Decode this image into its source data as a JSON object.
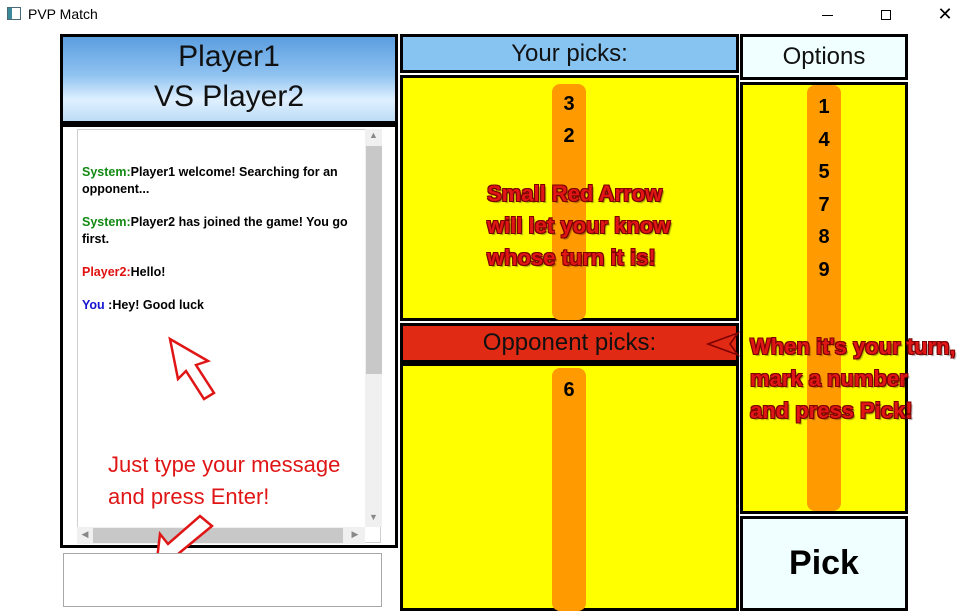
{
  "window": {
    "title": "PVP Match",
    "controls": {
      "minimize_icon": "minimize-icon",
      "maximize_icon": "maximize-icon",
      "close_icon": "close-icon",
      "close_glyph": "✕"
    }
  },
  "header": {
    "line1": "Player1",
    "line2": "VS Player2"
  },
  "chat": {
    "messages": [
      {
        "sender": "System:",
        "text": "Player1 welcome! Searching for an opponent...",
        "color": "#138a13"
      },
      {
        "sender": "System:",
        "text": "Player2 has joined the game! You go first.",
        "color": "#138a13"
      },
      {
        "sender": "Player2:",
        "text": "Hello!",
        "color": "#e01010"
      },
      {
        "sender": "You ",
        "text": ":Hey! Good luck",
        "color": "#1414d0"
      }
    ],
    "hint_line1": "Just type your message",
    "hint_line2": "and press Enter!",
    "input_value": ""
  },
  "your_picks": {
    "label": "Your picks:",
    "items": [
      "3",
      "2"
    ]
  },
  "turn_hint": {
    "line1": "Small Red Arrow",
    "line2": "will let your know",
    "line3": "whose turn it is!"
  },
  "opponent_picks": {
    "label": "Opponent picks:",
    "items": [
      "6"
    ]
  },
  "options": {
    "label": "Options",
    "items": [
      "1",
      "4",
      "5",
      "7",
      "8",
      "9"
    ]
  },
  "pick_hint": {
    "line1": "When it's your turn,",
    "line2": "mark a number",
    "line3": "and press Pick!"
  },
  "pick_button": {
    "label": "Pick"
  },
  "colors": {
    "your_header": "#87c4f2",
    "opponent_header": "#e02a14",
    "panel_yellow": "#ffff00",
    "bar_orange": "#ff9a00",
    "annotation_red": "#e01616"
  }
}
